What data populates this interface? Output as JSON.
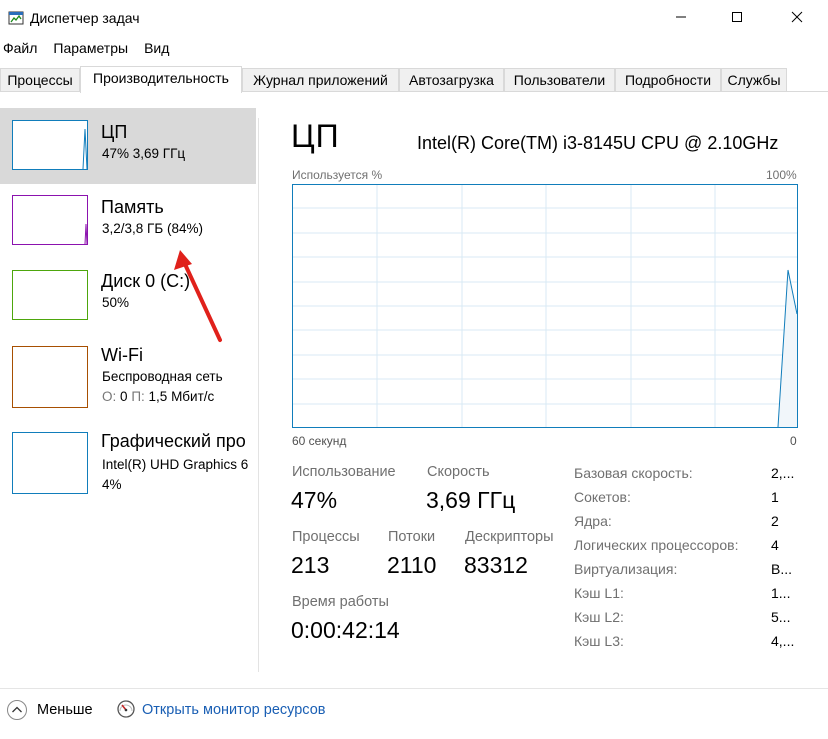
{
  "window": {
    "title": "Диспетчер задач"
  },
  "menu": [
    "Файл",
    "Параметры",
    "Вид"
  ],
  "tabs": [
    "Процессы",
    "Производительность",
    "Журнал приложений",
    "Автозагрузка",
    "Пользователи",
    "Подробности",
    "Службы"
  ],
  "active_tab": "Производительность",
  "sidebar": {
    "items": [
      {
        "name": "ЦП",
        "sub": "47% 3,69 ГГц",
        "color": "#117dbb",
        "selected": true
      },
      {
        "name": "Память",
        "sub": "3,2/3,8 ГБ (84%)",
        "color": "#8b12ae",
        "selected": false
      },
      {
        "name": "Диск 0 (C:)",
        "sub": "50%",
        "color": "#4da60c",
        "selected": false
      },
      {
        "name": "Wi-Fi",
        "sub": "Беспроводная сеть",
        "sub2_o_label": "О:",
        "sub2_o_value": "0",
        "sub2_p_label": "П:",
        "sub2_p_value": "1,5 Мбит/с",
        "color": "#a74f01",
        "selected": false
      },
      {
        "name": "Графический про",
        "sub": "Intel(R) UHD Graphics 6",
        "sub3": "4%",
        "color": "#117dbb",
        "selected": false
      }
    ]
  },
  "main": {
    "title": "ЦП",
    "cpu_model": "Intel(R) Core(TM) i3-8145U CPU @ 2.10GHz",
    "graph": {
      "top_left_label": "Используется %",
      "top_right_label": "100%",
      "bottom_left_label": "60 секунд",
      "bottom_right_label": "0",
      "line_color": "#117dbb",
      "grid_color": "#d9eaf4",
      "border_color": "#117dbb"
    },
    "stats": {
      "usage_label": "Использование",
      "usage_value": "47%",
      "speed_label": "Скорость",
      "speed_value": "3,69 ГГц",
      "processes_label": "Процессы",
      "processes_value": "213",
      "threads_label": "Потоки",
      "threads_value": "2110",
      "handles_label": "Дескрипторы",
      "handles_value": "83312",
      "uptime_label": "Время работы",
      "uptime_value": "0:00:42:14"
    },
    "details": [
      {
        "label": "Базовая скорость:",
        "value": "2,..."
      },
      {
        "label": "Сокетов:",
        "value": "1"
      },
      {
        "label": "Ядра:",
        "value": "2"
      },
      {
        "label": "Логических процессоров:",
        "value": "4"
      },
      {
        "label": "Виртуализация:",
        "value": "В..."
      },
      {
        "label": "Кэш L1:",
        "value": "1..."
      },
      {
        "label": "Кэш L2:",
        "value": "5..."
      },
      {
        "label": "Кэш L3:",
        "value": "4,..."
      }
    ]
  },
  "footer": {
    "less_label": "Меньше",
    "resource_monitor_label": "Открыть монитор ресурсов"
  }
}
